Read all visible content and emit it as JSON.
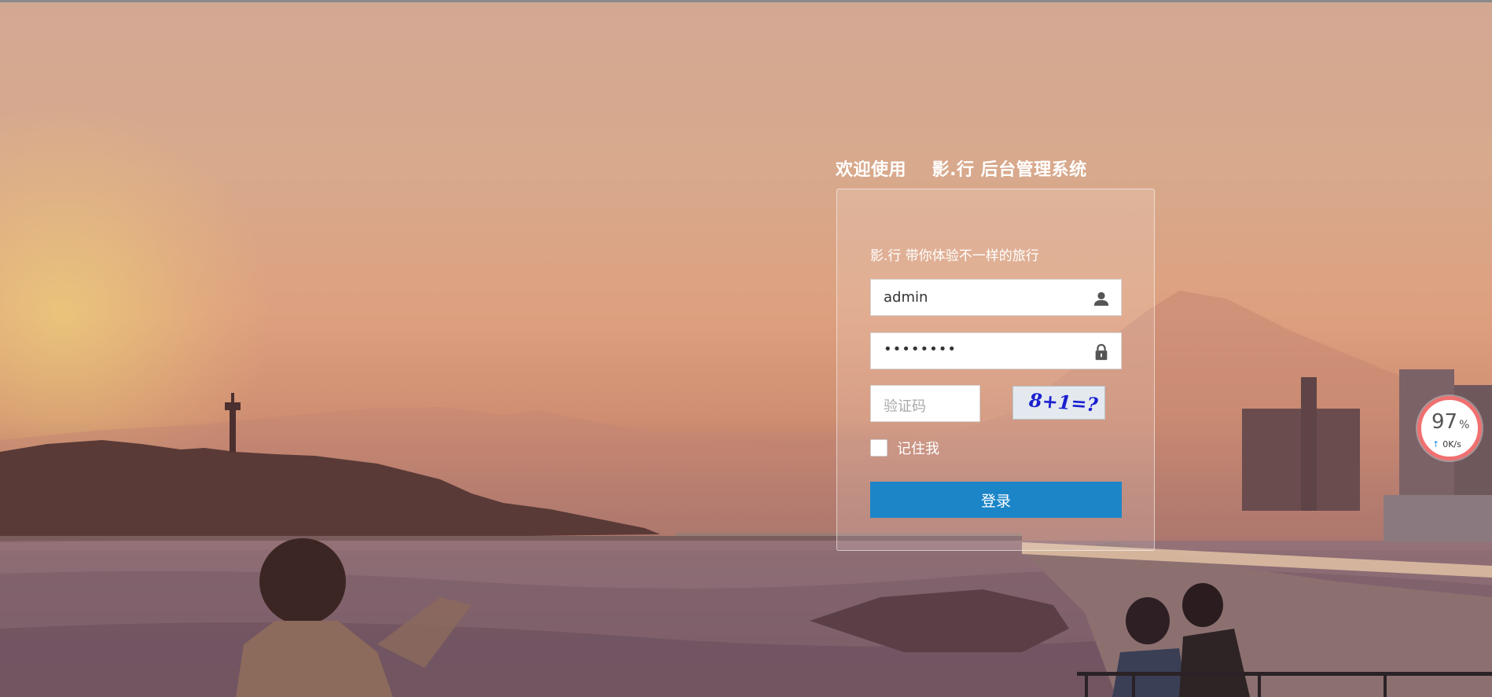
{
  "header": {
    "title": "欢迎使用    影.行 后台管理系统"
  },
  "login": {
    "tagline": "影.行 带你体验不一样的旅行",
    "username_value": "admin",
    "password_value": "••••••••",
    "captcha_placeholder": "验证码",
    "captcha_text": "8+1=?",
    "remember_label": "记住我",
    "login_button": "登录"
  },
  "widget": {
    "percent": "97",
    "percent_sign": "%",
    "speed": "0K/s"
  },
  "colors": {
    "button": "#1b85c8",
    "widget_ring": "#f07070"
  },
  "icons": {
    "username": "user-icon",
    "password": "lock-icon",
    "speed": "upload-arrow-icon"
  }
}
